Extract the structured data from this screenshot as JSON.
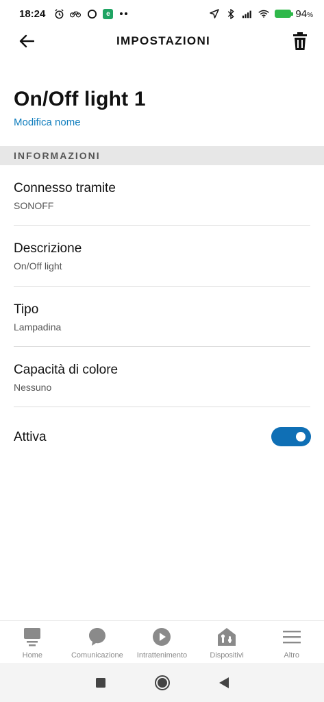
{
  "status_bar": {
    "time": "18:24",
    "battery_percent": "94",
    "battery_unit": "%",
    "left_icons": [
      "alarm-icon",
      "bike-icon",
      "circle-icon",
      "evernote-icon",
      "more-dots-icon"
    ],
    "right_icons": [
      "location-icon",
      "bluetooth-icon",
      "signal-icon",
      "wifi-icon",
      "battery-icon"
    ]
  },
  "app_bar": {
    "back_icon": "back-arrow-icon",
    "title": "IMPOSTAZIONI",
    "delete_icon": "trash-icon"
  },
  "device": {
    "name": "On/Off light 1",
    "rename_label": "Modifica nome"
  },
  "section": {
    "header": "INFORMAZIONI"
  },
  "info_rows": [
    {
      "title": "Connesso tramite",
      "value": "SONOFF"
    },
    {
      "title": "Descrizione",
      "value": "On/Off light"
    },
    {
      "title": "Tipo",
      "value": "Lampadina"
    },
    {
      "title": "Capacità di colore",
      "value": "Nessuno"
    }
  ],
  "enabled": {
    "label": "Attiva",
    "on": true
  },
  "bottom_nav": [
    {
      "label": "Home",
      "icon": "home-icon"
    },
    {
      "label": "Comunicazione",
      "icon": "chat-bubble-icon"
    },
    {
      "label": "Intrattenimento",
      "icon": "play-icon"
    },
    {
      "label": "Dispositivi",
      "icon": "devices-icon"
    },
    {
      "label": "Altro",
      "icon": "menu-icon"
    }
  ],
  "colors": {
    "accent": "#0f7dbd",
    "toggle_on": "#0f6fb5",
    "battery": "#2fb84a",
    "nav_inactive": "#8a8a8a"
  }
}
